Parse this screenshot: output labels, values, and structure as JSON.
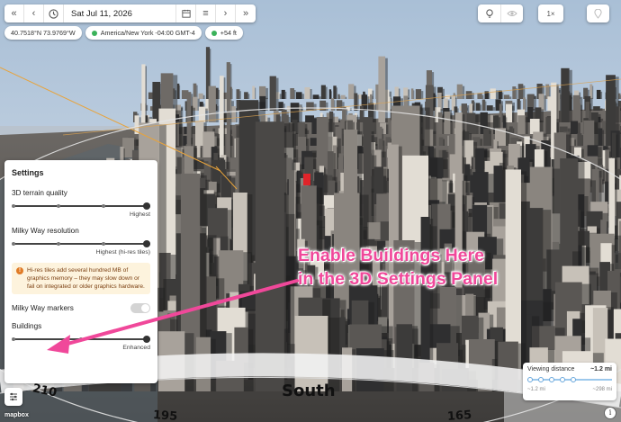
{
  "toolbar": {
    "date": "Sat Jul 11, 2026",
    "icons": [
      "double-chevron-left-icon",
      "chevron-left-icon",
      "clock-icon",
      "calendar-icon",
      "menu-icon",
      "chevron-right-icon",
      "double-chevron-right-icon"
    ]
  },
  "right_tools": {
    "speed": "1×",
    "icons": [
      "lightbulb-icon",
      "eye-icon",
      "map-pin-icon"
    ]
  },
  "chips": {
    "coordinates": "40.7518°N 73.9769°W",
    "timezone": "America/New York  -04:00 GMT-4",
    "elevation": "+54 ft"
  },
  "settings": {
    "title": "Settings",
    "terrain": {
      "label": "3D terrain quality",
      "caption": "Highest",
      "level": 1.0
    },
    "milky_way": {
      "label": "Milky Way resolution",
      "caption": "Highest (hi-res tiles)",
      "level": 1.0
    },
    "warning": "Hi-res tiles add several hundred MB of graphics memory – they may slow down or fail on integrated or older graphics hardware.",
    "markers": {
      "label": "Milky Way markers",
      "enabled": false
    },
    "buildings": {
      "label": "Buildings",
      "caption": "Enhanced",
      "level": 1.0
    }
  },
  "annotation": {
    "line1": "Enable Buildings Here",
    "line2": "in the 3D Settings Panel",
    "color": "#f0489a"
  },
  "viewing_distance": {
    "label": "Viewing distance",
    "value": "~1.2 mi",
    "min": "~1.2 mi",
    "max": "~298 mi"
  },
  "compass": {
    "labels": [
      "210",
      "195",
      "South",
      "165"
    ]
  },
  "footer": {
    "logo": "mapbox",
    "info": "i"
  }
}
